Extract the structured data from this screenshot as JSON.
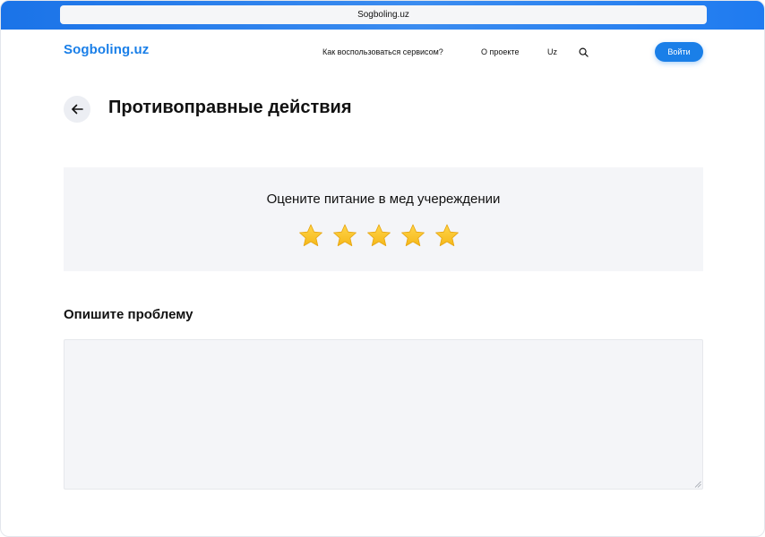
{
  "browser": {
    "url": "Sogboling.uz"
  },
  "header": {
    "logo": "Sogboling.uz",
    "nav": {
      "how_to_use": "Как воспользоваться сервисом?",
      "about": "О проекте",
      "language": "Uz"
    },
    "login_label": "Войти"
  },
  "page": {
    "title": "Противоправные действия"
  },
  "rating": {
    "question": "Оцените питание в мед учереждении",
    "max_stars": 5,
    "filled_stars": 5
  },
  "problem": {
    "label": "Опишите проблему",
    "value": "",
    "placeholder": ""
  },
  "colors": {
    "accent": "#1a7fe8",
    "card_background": "#f4f5f8",
    "star": "#f5b819"
  },
  "icons": {
    "back": "arrow-left-icon",
    "search": "search-icon",
    "star": "star-icon"
  }
}
